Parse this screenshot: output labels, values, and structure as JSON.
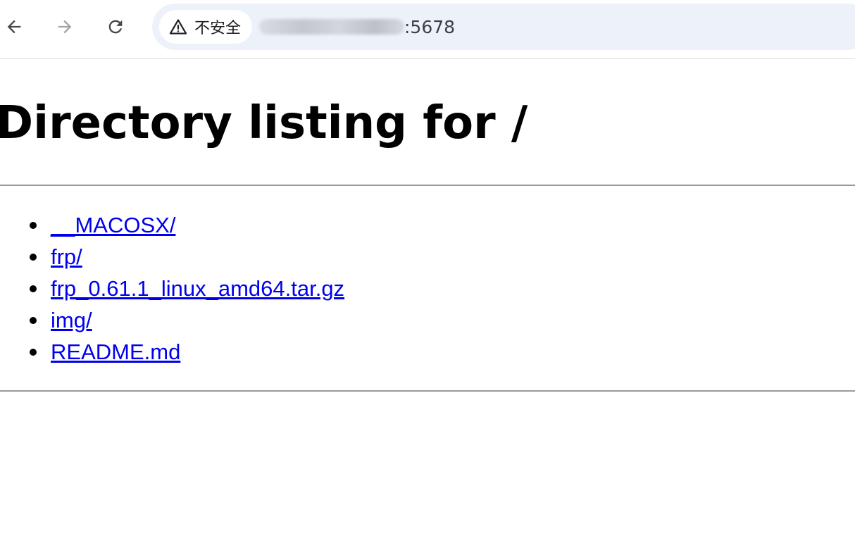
{
  "toolbar": {
    "back_icon": "arrow-left-icon",
    "forward_icon": "arrow-right-icon",
    "reload_icon": "reload-icon",
    "security_icon": "warning-triangle-icon",
    "security_label": "不安全",
    "url_port": ":5678"
  },
  "page": {
    "title": "Directory listing for /",
    "entries": [
      "__MACOSX/",
      "frp/",
      "frp_0.61.1_linux_amd64.tar.gz",
      "img/",
      "README.md"
    ]
  },
  "colors": {
    "link": "#0000ee",
    "omnibox_bg": "#edf2fa",
    "rule": "#9a9a9a"
  }
}
